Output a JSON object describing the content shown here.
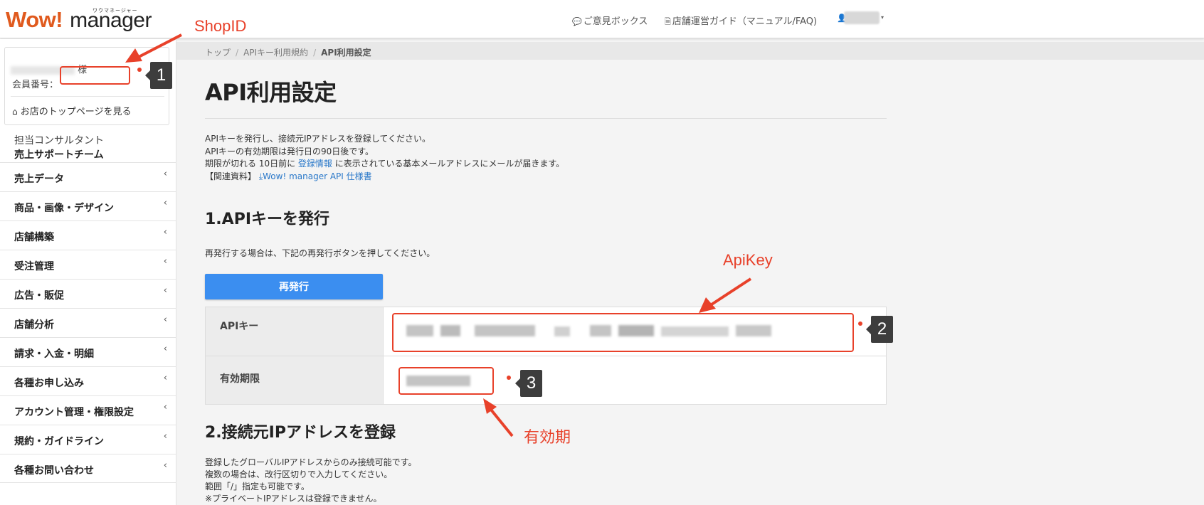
{
  "header": {
    "logo_main": "Wow!",
    "logo_sub": "manager",
    "logo_ruby": "ワウマネージャー",
    "feedback_label": "ご意見ボックス",
    "guide_label": "店舗運営ガイド（マニュアル/FAQ)"
  },
  "sidebar": {
    "member_suffix": "様",
    "member_no_label": "会員番号：",
    "top_page_link": "お店のトップページを見る",
    "consultant_label": "担当コンサルタント",
    "consultant_team": "売上サポートチーム",
    "nav_items": [
      {
        "label": "売上データ"
      },
      {
        "label": "商品・画像・デザイン"
      },
      {
        "label": "店舗構築"
      },
      {
        "label": "受注管理"
      },
      {
        "label": "広告・販促"
      },
      {
        "label": "店舗分析"
      },
      {
        "label": "請求・入金・明細"
      },
      {
        "label": "各種お申し込み"
      },
      {
        "label": "アカウント管理・権限設定"
      },
      {
        "label": "規約・ガイドライン"
      },
      {
        "label": "各種お問い合わせ"
      }
    ]
  },
  "breadcrumb": [
    "トップ",
    "APIキー利用規約",
    "API利用設定"
  ],
  "page": {
    "title": "API利用設定",
    "desc_line1": "APIキーを発行し、接続元IPアドレスを登録してください。",
    "desc_line2": "APIキーの有効期限は発行日の90日後です。",
    "desc_line3_pre": "期限が切れる 10日前に ",
    "desc_line3_link": "登録情報",
    "desc_line3_post": " に表示されている基本メールアドレスにメールが届きます。",
    "desc_line4_pre": "【関連資料】 ",
    "desc_line4_link": "Wow! manager API 仕様書",
    "section1_title": "1.APIキーを発行",
    "section1_note": "再発行する場合は、下記の再発行ボタンを押してください。",
    "reissue_button": "再発行",
    "api_key_label": "APIキー",
    "expiry_label": "有効期限",
    "section2_title": "2.接続元IPアドレスを登録",
    "section2_note1": "登録したグローバルIPアドレスからのみ接続可能です。",
    "section2_note2": "複数の場合は、改行区切りで入力してください。",
    "section2_note3": "範囲「/」指定も可能です。",
    "section2_note4": "※プライベートIPアドレスは登録できません。"
  },
  "annotations": {
    "shopid_label": "ShopID",
    "apikey_label": "ApiKey",
    "expiry_ann_label": "有効期",
    "badge1": "1",
    "badge2": "2",
    "badge3": "3",
    "accent_color": "#e8412a"
  },
  "colors": {
    "brand": "#e05a1e",
    "primary_button": "#3b8ef0",
    "link": "#2a78c9"
  }
}
